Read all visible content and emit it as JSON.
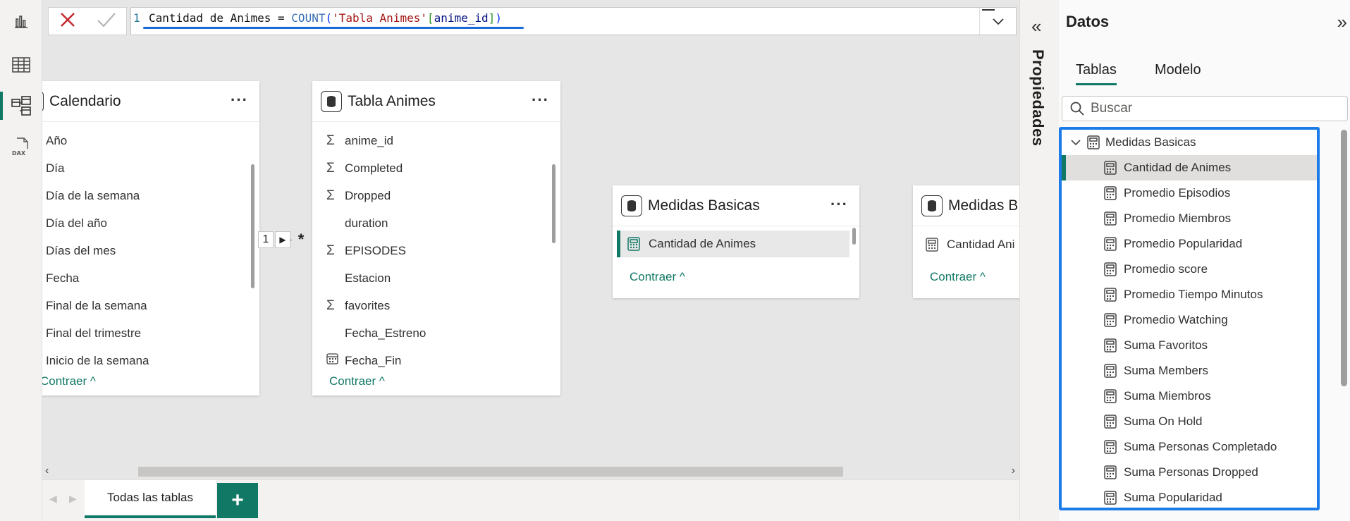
{
  "rail": {
    "icons": [
      "report-view-icon",
      "table-view-icon",
      "model-view-icon",
      "dax-query-view-icon"
    ],
    "dax_label": "DAX"
  },
  "formula_bar": {
    "line_number": "1",
    "measure_name": "Cantidad de Animes",
    "equals": " = ",
    "function": "COUNT",
    "open_paren": "(",
    "table_ref": "'Tabla Animes'",
    "bracket_open": "[",
    "column": "anime_id",
    "bracket_close": "]",
    "close_paren": ")"
  },
  "canvas": {
    "cards": {
      "calendario": {
        "title": "Calendario",
        "fields": [
          "Año",
          "Día",
          "Día de la semana",
          "Día del año",
          "Días del mes",
          "Fecha",
          "Final de la semana",
          "Final del trimestre",
          "Inicio de la semana"
        ],
        "collapse": "Contraer"
      },
      "tabla_animes": {
        "title": "Tabla Animes",
        "fields": [
          {
            "name": "anime_id",
            "icon": "Σ"
          },
          {
            "name": "Completed",
            "icon": "Σ"
          },
          {
            "name": "Dropped",
            "icon": "Σ"
          },
          {
            "name": "duration",
            "icon": ""
          },
          {
            "name": "EPISODES",
            "icon": "Σ"
          },
          {
            "name": "Estacion",
            "icon": ""
          },
          {
            "name": "favorites",
            "icon": "Σ"
          },
          {
            "name": "Fecha_Estreno",
            "icon": ""
          },
          {
            "name": "Fecha_Fin",
            "icon": "calendar-icon"
          }
        ],
        "collapse": "Contraer"
      },
      "medidas_basicas": {
        "title": "Medidas Basicas",
        "fields": [
          "Cantidad de Animes"
        ],
        "collapse": "Contraer"
      },
      "medidas_basicas_2": {
        "title": "Medidas B",
        "fields": [
          "Cantidad Ani"
        ],
        "collapse": "Contraer"
      }
    },
    "relationship": {
      "from": "1",
      "to": "*"
    }
  },
  "tabs": {
    "items": [
      "Todas las tablas"
    ],
    "add": "+"
  },
  "properties": {
    "label": "Propiedades"
  },
  "data_pane": {
    "title": "Datos",
    "tabs": [
      "Tablas",
      "Modelo"
    ],
    "search_placeholder": "Buscar",
    "table_name": "Medidas Basicas",
    "measures": [
      "Cantidad de Animes",
      "Promedio Episodios",
      "Promedio Miembros",
      "Promedio Popularidad",
      "Promedio score",
      "Promedio Tiempo Minutos",
      "Promedio Watching",
      "Suma Favoritos",
      "Suma Members",
      "Suma Miembros",
      "Suma On Hold",
      "Suma Personas Completado",
      "Suma Personas Dropped",
      "Suma Popularidad"
    ]
  },
  "colors": {
    "accent": "#117865",
    "highlight": "#1b7be8",
    "cancel": "#c4262e"
  }
}
